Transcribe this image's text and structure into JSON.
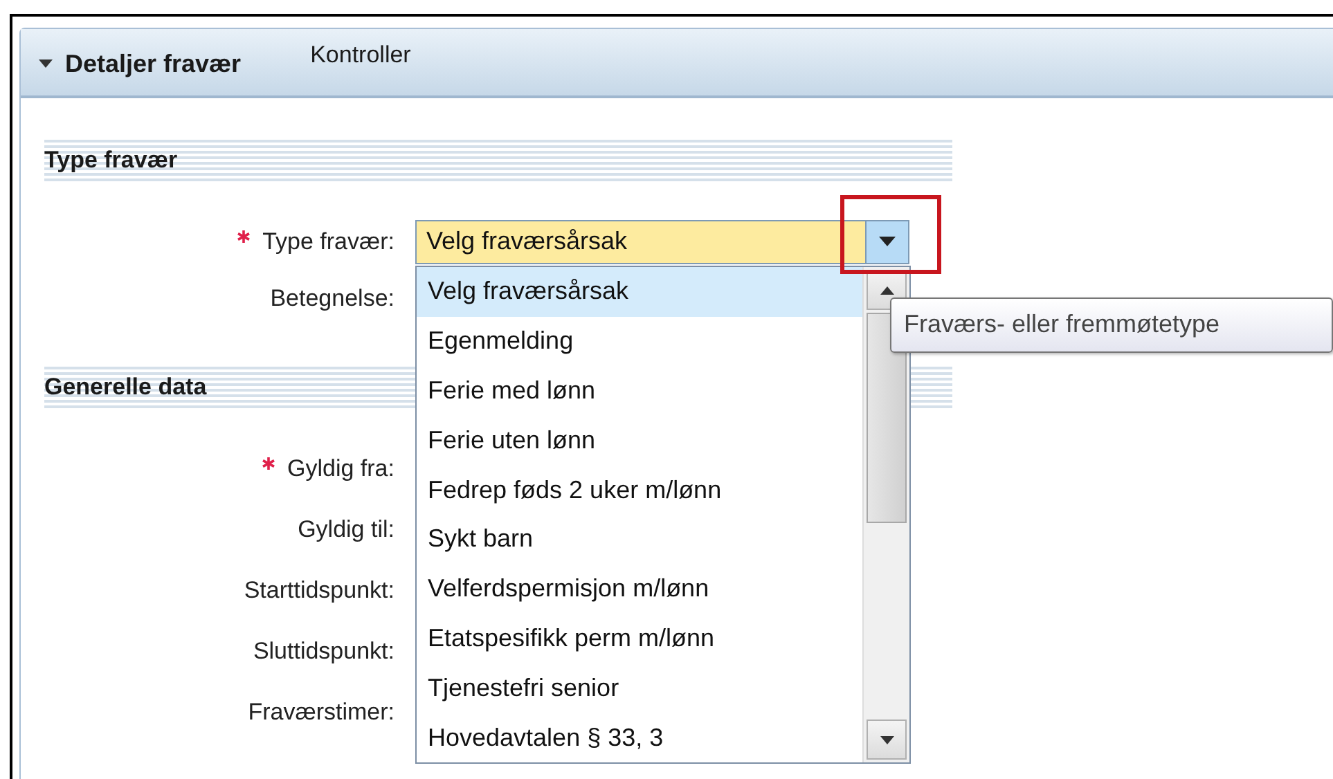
{
  "panel": {
    "title": "Detaljer fravær",
    "expanded": true,
    "tabs": [
      {
        "label": "Kontroller"
      }
    ]
  },
  "sections": [
    {
      "title": "Type fravær",
      "fields": [
        {
          "label": "Type fravær:",
          "required": true,
          "kind": "combo",
          "value": "Velg fraværsårsak",
          "focused": true
        },
        {
          "label": "Betegnelse:",
          "required": false,
          "kind": "hidden"
        }
      ]
    },
    {
      "title": "Generelle data",
      "fields": [
        {
          "label": "Gyldig fra:",
          "required": true,
          "kind": "hidden"
        },
        {
          "label": "Gyldig til:",
          "required": false,
          "kind": "hidden"
        },
        {
          "label": "Starttidspunkt:",
          "required": false,
          "kind": "hidden"
        },
        {
          "label": "Sluttidspunkt:",
          "required": false,
          "kind": "hidden"
        },
        {
          "label": "Fraværstimer:",
          "required": false,
          "kind": "hidden"
        }
      ]
    }
  ],
  "dropdown": {
    "open": true,
    "options": [
      {
        "label": "Velg fraværsårsak",
        "selected": true
      },
      {
        "label": "Egenmelding",
        "selected": false
      },
      {
        "label": "Ferie med lønn",
        "selected": false
      },
      {
        "label": "Ferie uten lønn",
        "selected": false
      },
      {
        "label": "Fedrep føds 2 uker m/lønn",
        "selected": false
      },
      {
        "label": "Sykt barn",
        "selected": false
      },
      {
        "label": "Velferdspermisjon m/lønn",
        "selected": false
      },
      {
        "label": "Etatspesifikk perm m/lønn",
        "selected": false
      },
      {
        "label": "Tjenestefri senior",
        "selected": false
      },
      {
        "label": "Hovedavtalen § 33, 3",
        "selected": false
      }
    ]
  },
  "tooltip": {
    "text": "Fraværs- eller fremmøtetype"
  },
  "highlight": {
    "shown": true
  }
}
